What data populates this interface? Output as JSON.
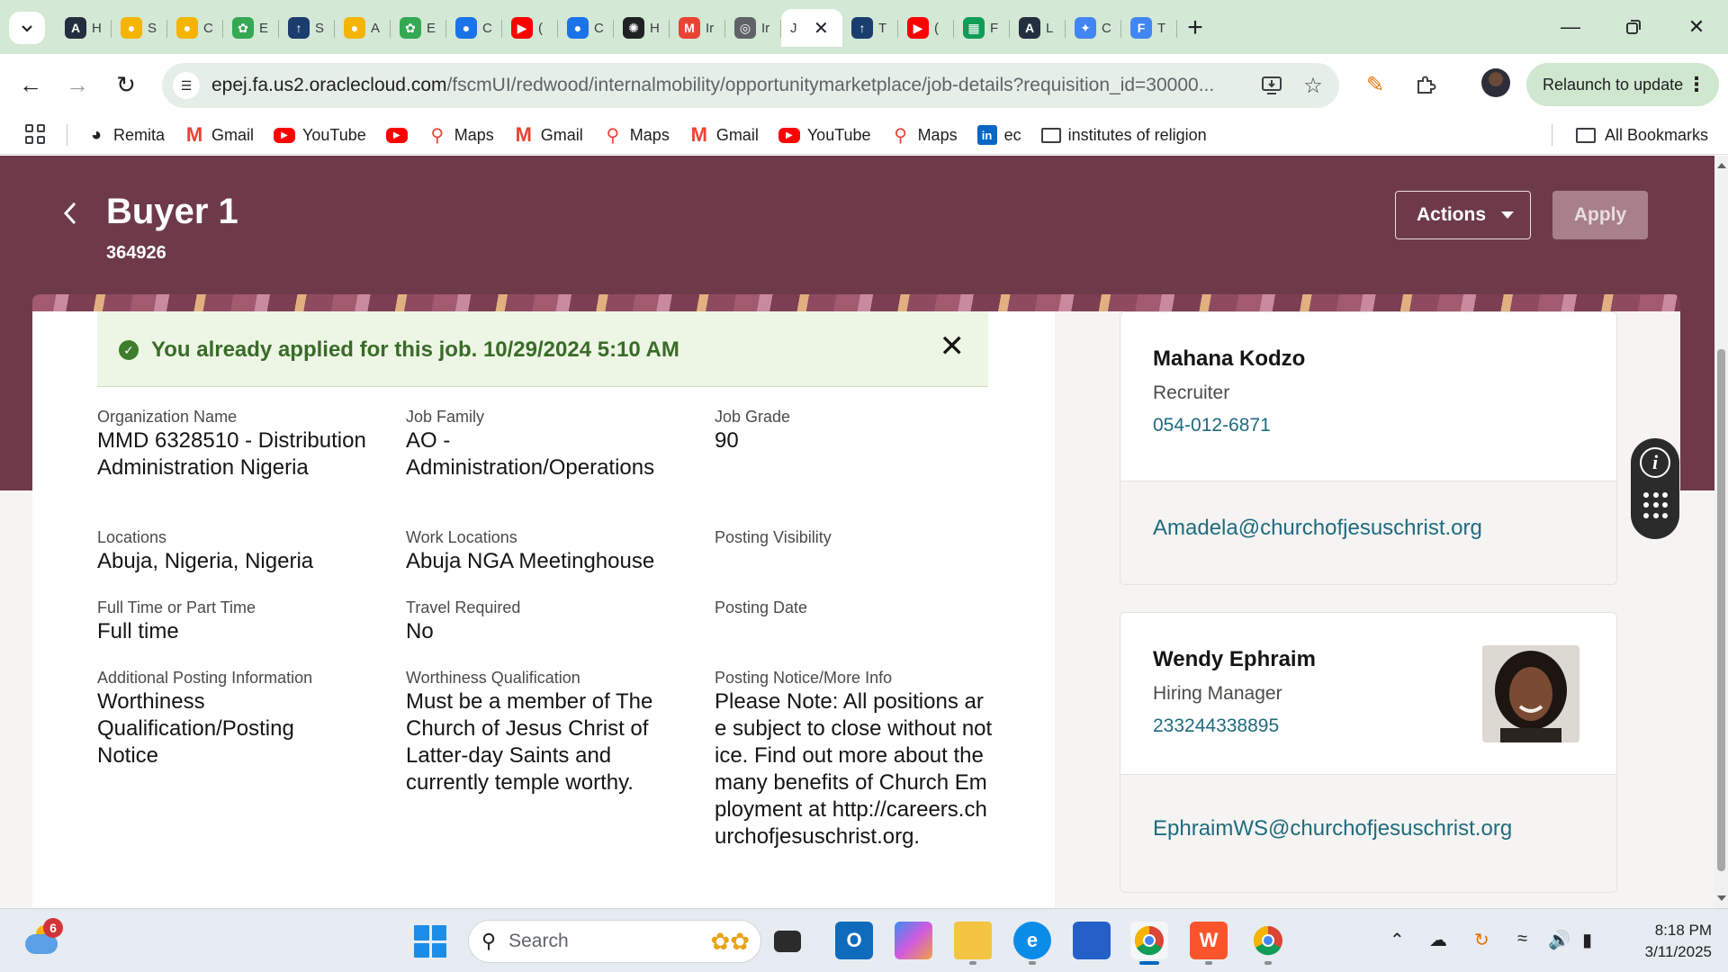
{
  "browser": {
    "tabs": [
      {
        "icon": "aws-icon",
        "title": "H",
        "color": "#232f3e"
      },
      {
        "icon": "spiral-icon",
        "title": "S",
        "color": "#f4b400"
      },
      {
        "icon": "spiral-icon",
        "title": "C",
        "color": "#f4b400"
      },
      {
        "icon": "flower-icon",
        "title": "E",
        "color": "#34a853"
      },
      {
        "icon": "temple-icon",
        "title": "S",
        "color": "#1a3d6e"
      },
      {
        "icon": "spiral-icon",
        "title": "A",
        "color": "#f4b400"
      },
      {
        "icon": "flower-icon",
        "title": "E",
        "color": "#34a853"
      },
      {
        "icon": "circle-icon",
        "title": "C",
        "color": "#1a73e8"
      },
      {
        "icon": "youtube-icon",
        "title": "(",
        "color": "#ff0000"
      },
      {
        "icon": "circle-icon",
        "title": "C",
        "color": "#1a73e8"
      },
      {
        "icon": "openai-icon",
        "title": "H",
        "color": "#202124"
      },
      {
        "icon": "gmail-icon",
        "title": "Ir",
        "color": "#ea4335"
      },
      {
        "icon": "target-icon",
        "title": "Ir",
        "color": "#5f6368"
      },
      {
        "icon": "temple-icon",
        "title": "T",
        "color": "#1a3d6e"
      },
      {
        "icon": "youtube-icon",
        "title": "(",
        "color": "#ff0000"
      },
      {
        "icon": "sheets-icon",
        "title": "F",
        "color": "#0f9d58"
      },
      {
        "icon": "aws-icon",
        "title": "L",
        "color": "#232f3e"
      },
      {
        "icon": "gemini-icon",
        "title": "C",
        "color": "#4285f4"
      },
      {
        "icon": "form-icon",
        "title": "T",
        "color": "#4285f4"
      }
    ],
    "active_tab": {
      "title": "J"
    },
    "url_domain": "epej.fa.us2.oraclecloud.com",
    "url_path": "/fscmUI/redwood/internalmobility/opportunitymarketplace/job-details?requisition_id=30000...",
    "relaunch_label": "Relaunch to update",
    "bookmarks": [
      {
        "icon": "remita-icon",
        "label": "Remita"
      },
      {
        "icon": "gmail-icon",
        "label": "Gmail"
      },
      {
        "icon": "youtube-icon",
        "label": "YouTube"
      },
      {
        "icon": "youtube-icon",
        "label": ""
      },
      {
        "icon": "maps-icon",
        "label": "Maps"
      },
      {
        "icon": "gmail-icon",
        "label": "Gmail"
      },
      {
        "icon": "maps-icon",
        "label": "Maps"
      },
      {
        "icon": "gmail-icon",
        "label": "Gmail"
      },
      {
        "icon": "youtube-icon",
        "label": "YouTube"
      },
      {
        "icon": "maps-icon",
        "label": "Maps"
      },
      {
        "icon": "linkedin-icon",
        "label": "ec"
      },
      {
        "icon": "folder-icon",
        "label": "institutes of religion"
      }
    ],
    "all_bookmarks_label": "All Bookmarks"
  },
  "header": {
    "title": "Buyer 1",
    "requisition_number": "364926",
    "actions_label": "Actions",
    "apply_label": "Apply"
  },
  "banner": {
    "message": "You already applied for this job. 10/29/2024 5:10 AM"
  },
  "details": [
    {
      "label": "Organization Name",
      "value": "MMD 6328510 - Distribution Administration Nigeria"
    },
    {
      "label": "Job Family",
      "value": "AO - Administration/Operations"
    },
    {
      "label": "Job Grade",
      "value": "90"
    },
    {
      "label": "Locations",
      "value": "Abuja, Nigeria, Nigeria"
    },
    {
      "label": "Work Locations",
      "value": "Abuja NGA Meetinghouse"
    },
    {
      "label": "Posting Visibility",
      "value": ""
    },
    {
      "label": "Full Time or Part Time",
      "value": "Full time"
    },
    {
      "label": "Travel Required",
      "value": "No"
    },
    {
      "label": "Posting Date",
      "value": ""
    },
    {
      "label": "Additional Posting Information",
      "value": "Worthiness Qualification/Posting Notice"
    },
    {
      "label": "Worthiness Qualification",
      "value": "Must be a member of The Church of Jesus Christ of Latter-day Saints and currently temple worthy."
    },
    {
      "label": "Posting Notice/More Info",
      "value": "Please Note: All positions are subject to close without notice. Find out more about the many benefits of Church Employment at http://careers.churchofjesuschrist.org."
    }
  ],
  "contacts": [
    {
      "name": "Mahana Kodzo",
      "role": "Recruiter",
      "phone": "054-012-6871",
      "email": "Amadela@churchofjesuschrist.org"
    },
    {
      "name": "Wendy Ephraim",
      "role": "Hiring Manager",
      "phone": "233244338895",
      "email": "EphraimWS@churchofjesuschrist.org"
    }
  ],
  "taskbar": {
    "weather_badge": "6",
    "search_label": "Search",
    "time": "8:18 PM",
    "date": "3/11/2025"
  },
  "colors": {
    "hero": "#6e3a4a",
    "success_text": "#3a6b2a",
    "link": "#1f6b80",
    "tab_strip": "#d3e8d5"
  }
}
